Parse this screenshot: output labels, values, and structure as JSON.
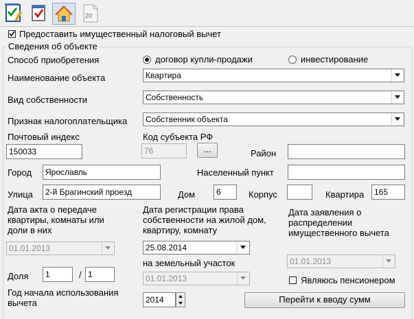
{
  "toolbar": {
    "buttons": [
      {
        "name": "declaration-edit",
        "icon": "checklist-pencil-icon"
      },
      {
        "name": "check",
        "icon": "checklist-icon"
      },
      {
        "name": "property",
        "icon": "house-icon",
        "active": true
      },
      {
        "name": "year",
        "icon": "page-icon",
        "text": "20"
      }
    ]
  },
  "deduction_checkbox": {
    "label": "Предоставить имущественный налоговый вычет",
    "checked": true
  },
  "object": {
    "legend": "Сведения об объекте",
    "acquisition": {
      "label": "Способ приобретения",
      "options": [
        "договор купли-продажи",
        "инвестирование"
      ],
      "selected": 0
    },
    "name": {
      "label": "Наименование объекта",
      "value": "Квартира"
    },
    "ownership": {
      "label": "Вид собственности",
      "value": "Собственность"
    },
    "taxpayer": {
      "label": "Признак налогоплательщика",
      "value": "Собственник объекта"
    },
    "postal": {
      "label": "Почтовый индекс",
      "value": "150033"
    },
    "region": {
      "label": "Код субъекта РФ",
      "value": "76",
      "button": "..."
    },
    "district": {
      "label": "Район",
      "value": ""
    },
    "city": {
      "label": "Город",
      "value": "Ярославль"
    },
    "locality": {
      "label": "Населенный пункт",
      "value": ""
    },
    "street": {
      "label": "Улица",
      "value": "2-й Брагинский проезд"
    },
    "house": {
      "label": "Дом",
      "value": "6"
    },
    "building": {
      "label": "Корпус",
      "value": ""
    },
    "apartment": {
      "label": "Квартира",
      "value": "165"
    },
    "act_date": {
      "label": "Дата акта о передаче квартиры, комнаты или доли в них",
      "value": "01.01.2013"
    },
    "reg_date": {
      "label": "Дата регистрации права собственности на жилой дом, квартиру, комнату",
      "value": "25.08.2014"
    },
    "land_date": {
      "label": "на земельный участок",
      "value": "01.01.2013"
    },
    "app_date": {
      "label": "Дата заявления о распределении имущественного вычета",
      "value": "01.01.2013"
    },
    "share": {
      "label": "Доля",
      "numerator": "1",
      "separator": "/",
      "denominator": "1"
    },
    "pensioner": {
      "label": "Являюсь пенсионером",
      "checked": false
    },
    "start_year": {
      "label": "Год начала использования вычета",
      "value": "2014"
    },
    "goto_button": "Перейти к вводу сумм"
  }
}
